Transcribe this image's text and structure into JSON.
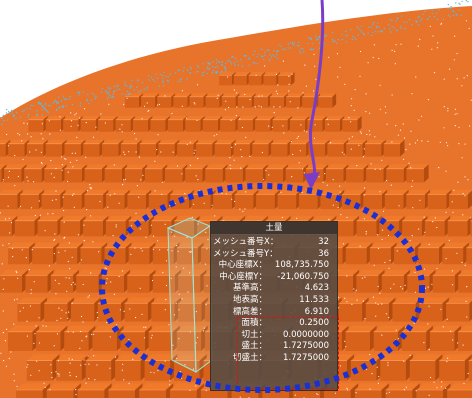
{
  "colors": {
    "block_top": "#f07a2a",
    "block_front": "#d9621a",
    "block_side": "#b44c10",
    "ground": "#e8732a",
    "point_cloud": "#62b8e0",
    "arrow": "#7a3dc8",
    "selection_ellipse": "#1a2fd6",
    "highlight_box": "#e01010",
    "panel_bg": "#554b44",
    "selected_column": "#9be7d8"
  },
  "icons": {
    "arrow": "curved-arrow-icon",
    "selection": "dashed-ellipse-icon"
  },
  "info_panel": {
    "title": "土量",
    "rows": [
      {
        "label": "メッシュ番号X：",
        "value": "32"
      },
      {
        "label": "メッシュ番号Y：",
        "value": "36"
      },
      {
        "label": "中心座標X：",
        "value": "108,735.750"
      },
      {
        "label": "中心座標Y：",
        "value": "-21,060.750"
      },
      {
        "label": "基準高：",
        "value": "4.623"
      },
      {
        "label": "地表高：",
        "value": "11.533"
      },
      {
        "label": "標高差：",
        "value": "6.910"
      },
      {
        "label": "面積：",
        "value": "0.2500"
      },
      {
        "label": "切土：",
        "value": "0.0000000"
      },
      {
        "label": "盛土：",
        "value": "1.7275000"
      },
      {
        "label": "切盛土：",
        "value": "1.7275000"
      }
    ]
  }
}
